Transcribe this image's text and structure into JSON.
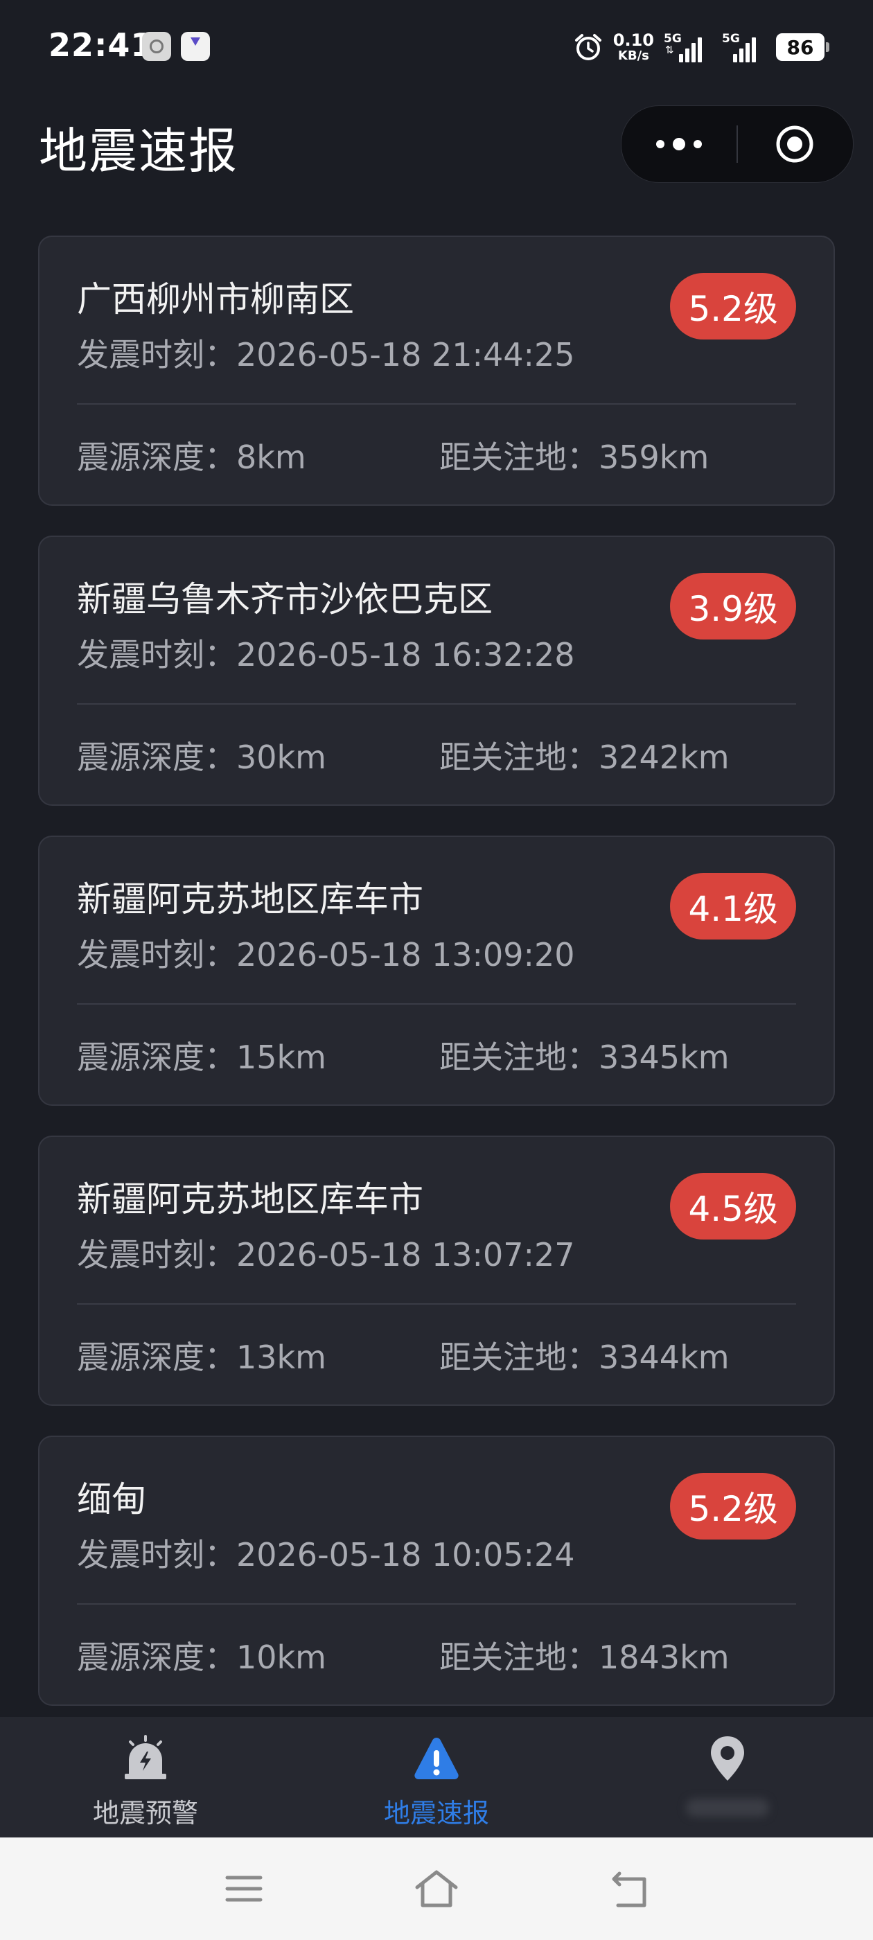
{
  "status_bar": {
    "time": "22:41",
    "net_speed_value": "0.10",
    "net_speed_unit": "KB/s",
    "signal_1": "5G",
    "signal_2": "5G",
    "battery": "86"
  },
  "header": {
    "title": "地震速报",
    "more_icon": "more-dots-icon",
    "close_icon": "target-circle-icon"
  },
  "earthquakes": [
    {
      "location": "广西柳州市柳南区",
      "time": "发震时刻：2026-05-18 21:44:25",
      "magnitude": "5.2级",
      "depth": "震源深度：8km",
      "distance": "距关注地：359km"
    },
    {
      "location": "新疆乌鲁木齐市沙依巴克区",
      "time": "发震时刻：2026-05-18 16:32:28",
      "magnitude": "3.9级",
      "depth": "震源深度：30km",
      "distance": "距关注地：3242km"
    },
    {
      "location": "新疆阿克苏地区库车市",
      "time": "发震时刻：2026-05-18 13:09:20",
      "magnitude": "4.1级",
      "depth": "震源深度：15km",
      "distance": "距关注地：3345km"
    },
    {
      "location": "新疆阿克苏地区库车市",
      "time": "发震时刻：2026-05-18 13:07:27",
      "magnitude": "4.5级",
      "depth": "震源深度：13km",
      "distance": "距关注地：3344km"
    },
    {
      "location": "缅甸",
      "time": "发震时刻：2026-05-18 10:05:24",
      "magnitude": "5.2级",
      "depth": "震源深度：10km",
      "distance": "距关注地：1843km"
    }
  ],
  "tabbar": {
    "tabs": [
      {
        "label": "地震预警",
        "icon": "alarm-bell-icon"
      },
      {
        "label": "地震速报",
        "icon": "warning-triangle-icon",
        "active": true
      },
      {
        "label": "",
        "icon": "location-pin-icon"
      }
    ]
  },
  "colors": {
    "background": "#1b1d24",
    "card": "#262830",
    "magnitude_badge": "#d9443d",
    "active_tab": "#2f7de6"
  }
}
